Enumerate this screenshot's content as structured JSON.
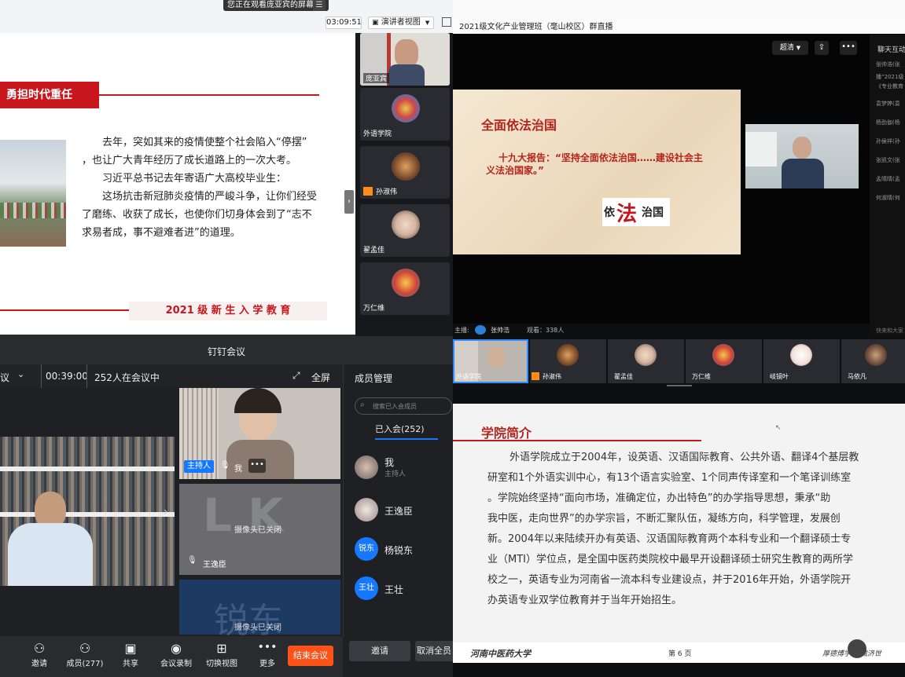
{
  "presenter": {
    "share_banner": "您正在观看庞亚宾的屏幕",
    "timer": "03:09:51",
    "view_mode": "演讲者视图",
    "slide": {
      "heading": "勇担时代重任",
      "para1": "去年，突如其来的疫情使整个社会陷入“停摆”",
      "para2": "，也让广大青年经历了成长道路上的一次大考。",
      "para3": "习近平总书记去年寄语广大高校毕业生：",
      "para4": "这场抗击新冠肺炎疫情的严峻斗争，让你们经受",
      "para5": "了磨练、收获了成长，也使你们切身体会到了“志不",
      "para6": "求易者成，事不避难者进”的道理。",
      "footer": "2021 级 新 生 入 学 教 育"
    },
    "thumbs": [
      "庞亚宾",
      "外语学院",
      "孙淑伟",
      "翟孟佳",
      "万仁维"
    ]
  },
  "live": {
    "title": "2021级文化产业管理班（毫山校区）群直播",
    "quality": "超清",
    "chat_tab": "聊天互动",
    "chat_lines": [
      "张帅浩(张",
      "播“2021级",
      "《专业教育",
      "袁梦婷(袁",
      "杨劲伽(杨",
      "孙侯祥(孙",
      "张凯文(张",
      "孟晴晴(孟",
      "何淑晴(何"
    ],
    "chat_input": "快来和大家",
    "slide": {
      "title": "全面依法治国",
      "quote": "十九大报告：“坚持全面依法治国……建设社会主",
      "quote2": "义法治国家。”",
      "logo_a": "依",
      "logo_b": "法",
      "logo_c": "治国"
    },
    "host_label": "主播:",
    "host_name": "张帅浩",
    "viewers": "观看：338人",
    "strip": [
      "外语学院",
      "孙淑伟",
      "翟孟佳",
      "万仁维",
      "岐镜叶",
      "马依凡"
    ]
  },
  "meeting": {
    "app_title": "钉钉会议",
    "left_partial": "议",
    "elapsed": "00:39:00",
    "in_meeting": "252人在会议中",
    "fullscreen": "全屏",
    "members_title": "成员管理",
    "search_placeholder": "搜索已入会成员",
    "joined_tab": "已入会(252)",
    "members": [
      {
        "name": "我",
        "role": "主持人"
      },
      {
        "name": "王逸臣",
        "role": ""
      },
      {
        "name": "杨锐东",
        "role": ""
      },
      {
        "name": "王壮",
        "role": ""
      }
    ],
    "avatar_rd": "锐东",
    "avatar_wz": "王壮",
    "tile_host_badge": "主持人",
    "tile_me": "我",
    "tile_cam_off": "摄像头已关闭",
    "tile_wyc": "王逸臣",
    "tile_bg_text": "锐东",
    "tile_cam_off2": "摄像头已关闭",
    "toolbar": [
      {
        "label": "邀请",
        "icon": "invite-icon"
      },
      {
        "label": "成员(277)",
        "icon": "members-icon"
      },
      {
        "label": "共享",
        "icon": "share-icon"
      },
      {
        "label": "会议录制",
        "icon": "record-icon"
      },
      {
        "label": "切换视图",
        "icon": "grid-icon"
      },
      {
        "label": "更多",
        "icon": "more-icon"
      }
    ],
    "end_button": "结束会议",
    "invite_button": "邀请",
    "cancel_all": "取消全员"
  },
  "college": {
    "heading": "学院简介",
    "lines": [
      "外语学院成立于2004年，设英语、汉语国际教育、公共外语、翻译4个基层教",
      "研室和1个外语实训中心，有13个语言实验室、1个同声传译室和一个笔译训练室",
      "。学院始终坚持“面向市场，准确定位，办出特色”的办学指导思想，秉承“助",
      "我中医，走向世界”的办学宗旨，不断汇聚队伍，凝练方向，科学管理，发展创",
      "新。2004年以来陆续开办有英语、汉语国际教育两个本科专业和一个翻译硕士专",
      "业（MTI）学位点，是全国中医药类院校中最早开设翻译硕士研究生教育的两所学",
      "校之一，英语专业为河南省一流本科专业建设点，并于2016年开始，外语学院开",
      "办英语专业双学位教育并于当年开始招生。"
    ],
    "footer_left": "河南中医药大学",
    "page": "第 6 页",
    "footer_right": "厚德博学 精诚济世"
  }
}
